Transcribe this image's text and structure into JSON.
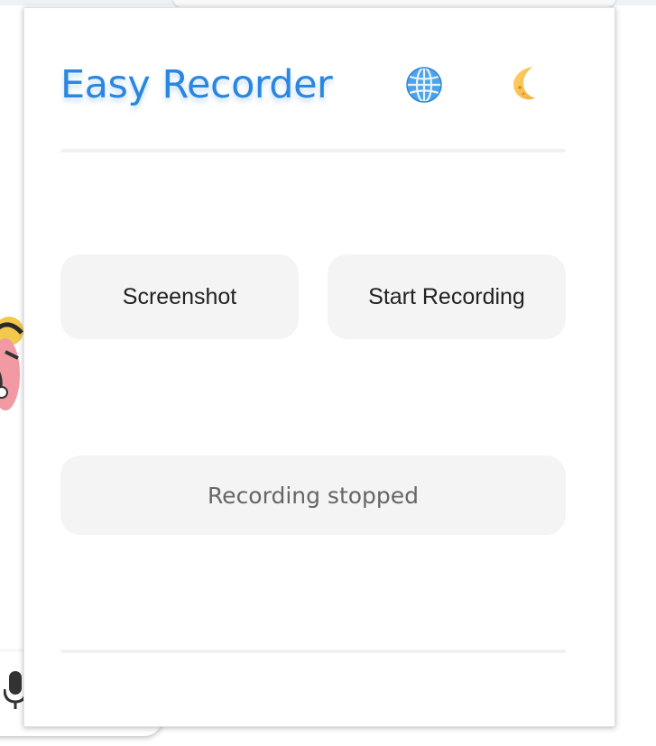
{
  "popup": {
    "title": "Easy Recorder",
    "title_color": "#2b86e0",
    "language_icon": "globe-icon",
    "theme_icon": "crescent-moon-icon",
    "buttons": {
      "screenshot_label": "Screenshot",
      "start_recording_label": "Start Recording"
    },
    "status_text": "Recording stopped"
  },
  "background": {
    "mic_icon": "microphone-icon"
  }
}
